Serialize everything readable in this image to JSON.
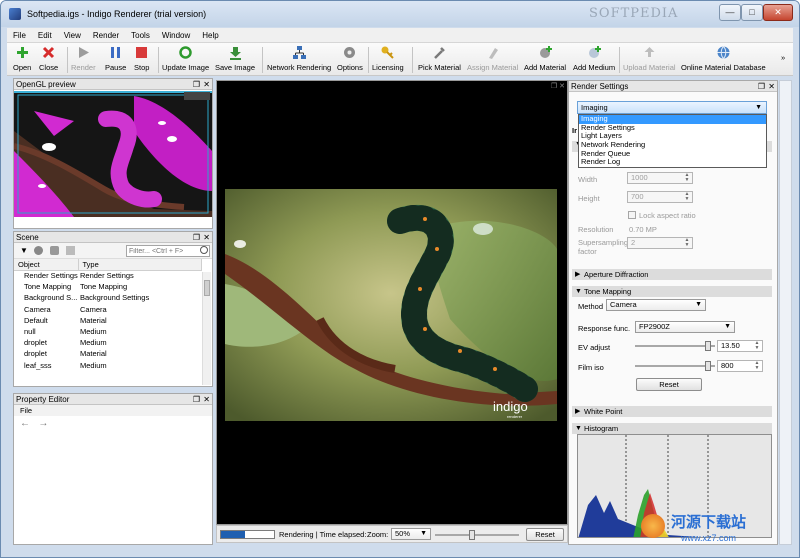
{
  "window": {
    "title": "Softpedia.igs - Indigo Renderer (trial version)",
    "watermark": "SOFTPEDIA"
  },
  "menu": [
    "File",
    "Edit",
    "View",
    "Render",
    "Tools",
    "Window",
    "Help"
  ],
  "toolbar": {
    "open": "Open",
    "close": "Close",
    "render": "Render",
    "pause": "Pause",
    "stop": "Stop",
    "update_image": "Update Image",
    "save_image": "Save Image",
    "network_rendering": "Network Rendering",
    "options": "Options",
    "licensing": "Licensing",
    "pick_material": "Pick Material",
    "assign_material": "Assign Material",
    "add_material": "Add Material",
    "add_medium": "Add Medium",
    "upload_material": "Upload Material",
    "online_material_database": "Online Material Database",
    "overflow": "»"
  },
  "opengl_panel": {
    "title": "OpenGL preview"
  },
  "scene_panel": {
    "title": "Scene",
    "filter_placeholder": "Filter... <Ctrl + F>",
    "columns": [
      "Object",
      "Type"
    ],
    "rows": [
      {
        "object": "Render Settings",
        "type": "Render Settings"
      },
      {
        "object": "Tone Mapping",
        "type": "Tone Mapping"
      },
      {
        "object": "Background S...",
        "type": "Background Settings"
      },
      {
        "object": "Camera",
        "type": "Camera"
      },
      {
        "object": "Default",
        "type": "Material"
      },
      {
        "object": "null",
        "type": "Medium"
      },
      {
        "object": "droplet",
        "type": "Medium"
      },
      {
        "object": "droplet",
        "type": "Material"
      },
      {
        "object": "leaf_sss",
        "type": "Medium"
      }
    ]
  },
  "property_panel": {
    "title": "Property Editor",
    "menu": "File"
  },
  "status": {
    "text": "Rendering | Time elapsed:",
    "zoom_label": "Zoom:",
    "zoom_value": "50%",
    "reset": "Reset",
    "progress": 0.45
  },
  "render_logo": "indigo",
  "render_logo_sub": "renderer",
  "render_settings": {
    "title": "Render Settings",
    "selected": "Imaging",
    "options": [
      "Imaging",
      "Render Settings",
      "Light Layers",
      "Network Rendering",
      "Render Queue",
      "Render Log"
    ],
    "partial_label": "Ir",
    "width_label": "Width",
    "width_value": "1000",
    "height_label": "Height",
    "height_value": "700",
    "lock_aspect": "Lock aspect ratio",
    "resolution_label": "Resolution",
    "resolution_value": "0.70 MP",
    "supersampling_label": "Supersampling factor",
    "supersampling_value": "2",
    "aperture": "Aperture Diffraction",
    "tone_mapping": "Tone Mapping",
    "method_label": "Method",
    "method_value": "Camera",
    "response_label": "Response func.",
    "response_value": "FP2900Z",
    "ev_label": "EV adjust",
    "ev_value": "13.50",
    "ev_level": 0.95,
    "iso_label": "Film iso",
    "iso_value": "800",
    "iso_level": 0.95,
    "reset": "Reset",
    "white_point": "White Point",
    "histogram": "Histogram"
  },
  "site_watermark": "河源下载站",
  "site_url": "www.xz7.com"
}
